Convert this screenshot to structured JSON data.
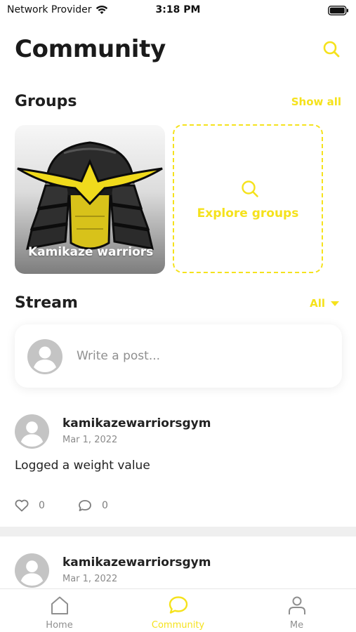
{
  "status_bar": {
    "carrier": "Network Provider",
    "time": "3:18 PM"
  },
  "header": {
    "title": "Community",
    "search_icon": "search-icon"
  },
  "groups": {
    "title": "Groups",
    "show_all": "Show all",
    "cards": [
      {
        "name": "Kamikaze warriors"
      }
    ],
    "explore_label": "Explore groups"
  },
  "stream": {
    "title": "Stream",
    "filter": "All",
    "composer_placeholder": "Write a post..."
  },
  "posts": [
    {
      "author": "kamikazewarriorsgym",
      "date": "Mar 1, 2022",
      "text": "Logged a weight value",
      "likes": "0",
      "comments": "0"
    },
    {
      "author": "kamikazewarriorsgym",
      "date": "Mar 1, 2022"
    }
  ],
  "tabs": [
    {
      "label": "Home",
      "icon": "home-icon"
    },
    {
      "label": "Community",
      "icon": "chat-bubble-icon",
      "active": true
    },
    {
      "label": "Me",
      "icon": "person-icon"
    }
  ],
  "colors": {
    "accent": "#f5e21c",
    "text": "#1c1c1c",
    "muted": "#8f8f8f"
  }
}
